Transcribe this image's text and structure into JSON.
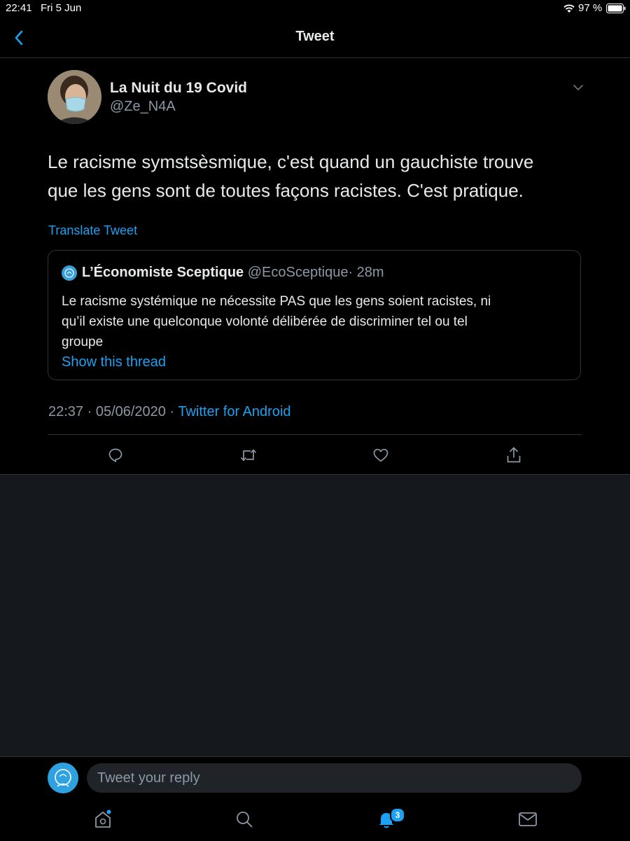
{
  "status_bar": {
    "time": "22:41",
    "date": "Fri 5 Jun",
    "battery": "97 %"
  },
  "header": {
    "title": "Tweet",
    "back_icon": "back-chevron-icon"
  },
  "tweet": {
    "author_name": "La Nuit du 19 Covid",
    "author_handle": "@Ze_N4A",
    "text_line1": "Le racisme symstsèsmique, c'est quand un gauchiste trouve",
    "text_line2": "que les gens sont de toutes façons racistes.  C'est pratique.",
    "translate_label": "Translate Tweet",
    "timestamp": "22:37 · 05/06/2020 · ",
    "source": "Twitter for Android"
  },
  "quoted_tweet": {
    "author_name": "L’Économiste Sceptique",
    "author_handle": "@EcoSceptique",
    "age": "· 28m",
    "text_line1": "Le racisme systémique ne nécessite PAS que les gens soient racistes, ni",
    "text_line2": "qu’il existe une quelconque volonté délibérée de discriminer tel ou tel",
    "text_line3": "groupe",
    "show_thread_label": "Show this thread"
  },
  "actions": [
    "reply-icon",
    "retweet-icon",
    "like-icon",
    "share-icon"
  ],
  "reply": {
    "placeholder": "Tweet your reply"
  },
  "tab_bar": {
    "items": [
      "home-icon",
      "search-icon",
      "notifications-icon",
      "messages-icon"
    ],
    "notification_count": "3"
  },
  "colors": {
    "accent": "#1da1f2",
    "background": "#000000",
    "secondary_bg": "#15181c"
  }
}
